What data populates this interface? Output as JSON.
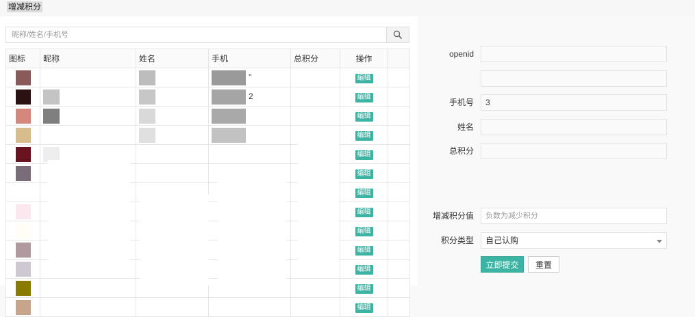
{
  "header": {
    "breadcrumb": "增减积分"
  },
  "search": {
    "placeholder": "昵称/姓名/手机号",
    "value": ""
  },
  "table": {
    "columns": [
      "图标",
      "昵称",
      "姓名",
      "手机",
      "总积分",
      "操作"
    ],
    "edit_label": "编辑",
    "rows": [
      {
        "avatar": "#8a5a5a",
        "g1": "",
        "g2": "#bdbdbd",
        "g3": "#9a9a9a",
        "phone": "''"
      },
      {
        "avatar": "#2b1111",
        "g1": "#c4c4c4",
        "g2": "#c7c7c7",
        "g3": "#a5a5a5",
        "phone": "2"
      },
      {
        "avatar": "#d4877a",
        "g1": "#7f7f7f",
        "g2": "#d9d9d9",
        "g3": "#a9a9a9",
        "phone": ""
      },
      {
        "avatar": "#d6bd8b",
        "g1": "",
        "g2": "#e0e0e0",
        "g3": "#c2c2c2",
        "phone": ""
      },
      {
        "avatar": "#6b1220",
        "g1": "#eeeeee",
        "g2": "",
        "g3": "",
        "phone": ""
      },
      {
        "avatar": "#7a6c79",
        "g1": "",
        "g2": "",
        "g3": "",
        "phone": ""
      },
      {
        "avatar": "#ffffff",
        "g1": "",
        "g2": "",
        "g3": "",
        "phone": ""
      },
      {
        "avatar": "#fbe8ee",
        "g1": "",
        "g2": "",
        "g3": "",
        "phone": ""
      },
      {
        "avatar": "#fffdf5",
        "g1": "",
        "g2": "",
        "g3": "",
        "phone": ""
      },
      {
        "avatar": "#b09aa0",
        "g1": "",
        "g2": "",
        "g3": "",
        "phone": ""
      },
      {
        "avatar": "#cdc8d2",
        "g1": "",
        "g2": "",
        "g3": "",
        "phone": ""
      },
      {
        "avatar": "#8a7a00",
        "g1": "",
        "g2": "",
        "g3": "",
        "phone": ""
      },
      {
        "avatar": "#c7a58a",
        "g1": "",
        "g2": "",
        "g3": "",
        "phone": ""
      }
    ]
  },
  "form": {
    "openid_label": "openid",
    "phone_label": "手机号",
    "phone_value": "3",
    "name_label": "姓名",
    "total_label": "总积分",
    "adjust_label": "增减积分值",
    "adjust_placeholder": "负数为减少积分",
    "type_label": "积分类型",
    "type_selected": "自己认购",
    "submit_label": "立即提交",
    "reset_label": "重置"
  },
  "colors": {
    "accent": "#3cb4a4",
    "background": "#f9f9f9"
  },
  "icons": {
    "search": "search-icon",
    "dropdown": "chevron-down-icon"
  }
}
